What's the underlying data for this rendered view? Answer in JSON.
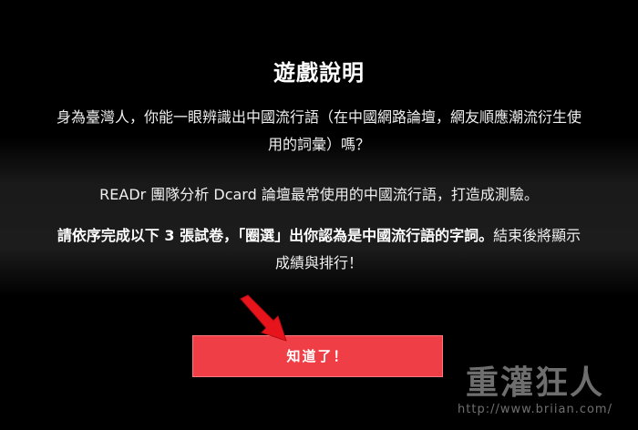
{
  "dialog": {
    "title": "遊戲說明",
    "paragraph1": "身為臺灣人，你能一眼辨識出中國流行語（在中國網路論壇，網友順應潮流衍生使用的詞彙）嗎？",
    "paragraph2": "READr 團隊分析 Dcard 論壇最常使用的中國流行語，打造成測驗。",
    "paragraph3_bold": "請依序完成以下 3 張試卷，「圈選」出你認為是中國流行語的字詞。",
    "paragraph3_rest": "結束後將顯示成績與排行！",
    "confirm_label": "知道了！"
  },
  "overlay": {
    "arrow_icon": "red-pointer-arrow-icon",
    "arrow_color": "#e8141b"
  },
  "watermark": {
    "title": "重灌狂人",
    "url": "http://www.briian.com/"
  },
  "colors": {
    "background": "#000000",
    "button": "#ef3e45",
    "text": "#f0f0f0"
  }
}
